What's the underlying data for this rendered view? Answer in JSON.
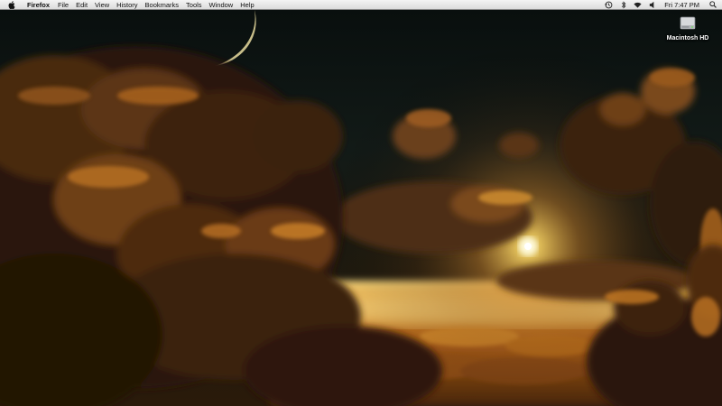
{
  "menubar": {
    "apple_icon": "apple-icon",
    "app_name": "Firefox",
    "items": [
      "File",
      "Edit",
      "View",
      "History",
      "Bookmarks",
      "Tools",
      "Window",
      "Help"
    ],
    "status_icons": [
      "time-machine-icon",
      "bluetooth-icon",
      "wifi-icon",
      "volume-icon"
    ],
    "clock": "Fri 7:47 PM",
    "search_icon": "spotlight-search-icon"
  },
  "desktop": {
    "icons": [
      {
        "label": "Macintosh HD",
        "icon": "hard-drive-icon"
      }
    ],
    "wallpaper": "sunset-clouds-with-crescent-moon"
  },
  "colors": {
    "sky": "#0b1211",
    "cloud_glow": "#e8a13a",
    "sun": "#f6f0a8",
    "menubar": "#e9e9e9"
  }
}
